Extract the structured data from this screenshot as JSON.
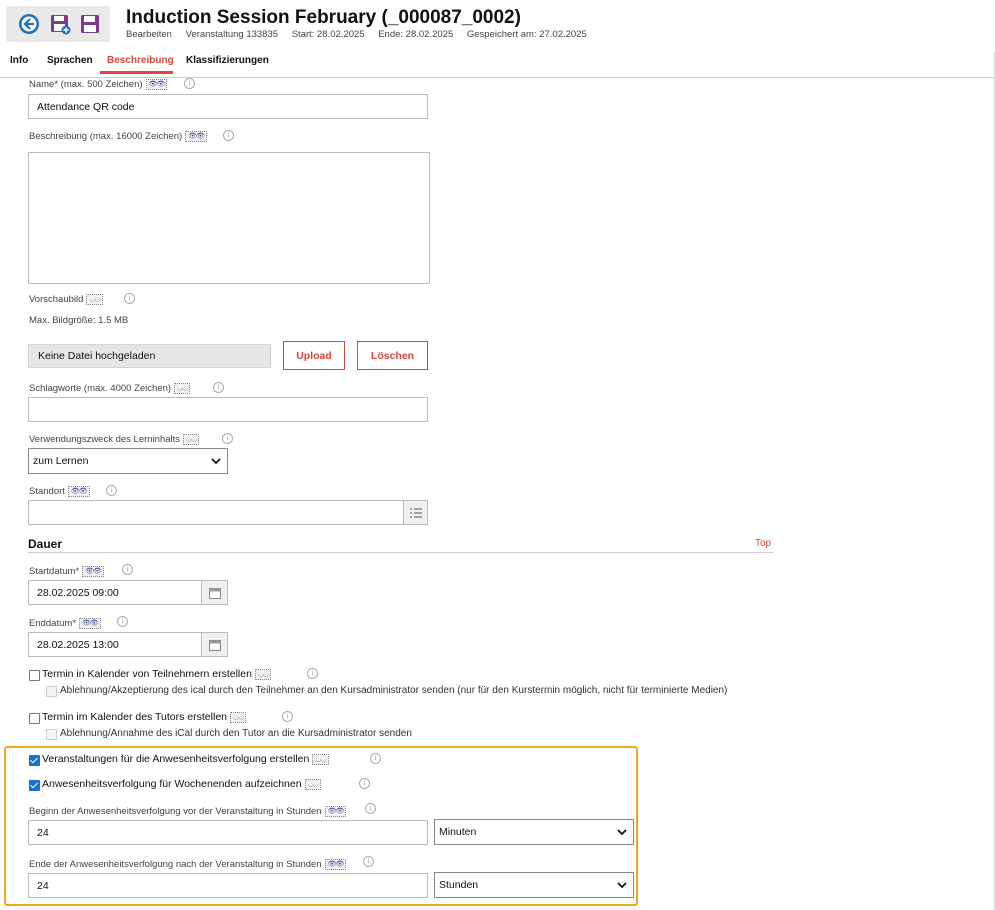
{
  "header": {
    "title": "Induction Session February (_000087_0002)",
    "meta": [
      "Bearbeiten",
      "Veranstaltung 133835",
      "Start: 28.02.2025",
      "Ende: 28.02.2025",
      "Gespeichert am: 27.02.2025"
    ],
    "toolbar_icons": [
      "back-icon",
      "save-new-icon",
      "save-icon"
    ]
  },
  "tabs": [
    {
      "label": "Info"
    },
    {
      "label": "Sprachen"
    },
    {
      "label": "Beschreibung",
      "active": true
    },
    {
      "label": "Klassifizierungen"
    }
  ],
  "form": {
    "name_label": "Name* (max. 500 Zeichen)",
    "name_value": "Attendance QR code",
    "beschreibung_label": "Beschreibung (max. 16000 Zeichen)",
    "vorschaubild_label": "Vorschaubild",
    "max_size": "Max. Bildgröße: 1.5 MB",
    "no_file": "Keine Datei hochgeladen",
    "upload": "Upload",
    "loeschen": "Löschen",
    "schlagworte_label": "Schlagworte (max. 4000 Zeichen)",
    "verwendung_label": "Verwendungszweck des Lerninhalts",
    "verwendung_value": "zum Lernen",
    "standort_label": "Standort"
  },
  "dauer": {
    "heading": "Dauer",
    "top_link": "Top",
    "start_label": "Startdatum*",
    "start_value": "28.02.2025 09:00",
    "end_label": "Enddatum*",
    "end_value": "28.02.2025 13:00",
    "cb1": "Termin in Kalender von Teilnehmern erstellen",
    "cb1_sub": "Ablehnung/Akzeptierung des ical durch den Teilnehmer an den Kursadministrator senden (nur für den Kurstermin möglich, nicht für terminierte Medien)",
    "cb2": "Termin im Kalender des Tutors erstellen",
    "cb2_sub": "Ablehnung/Annahme des iCal durch den Tutor an die Kursadministrator senden",
    "cb3": "Veranstaltungen für die Anwesenheitsverfolgung erstellen",
    "cb4": "Anwesenheitsverfolgung für Wochenenden aufzeichnen",
    "begin_label": "Beginn der Anwesenheitsverfolgung vor der Veranstaltung in Stunden",
    "begin_value": "24",
    "begin_unit": "Minuten",
    "end_track_label": "Ende der Anwesenheitsverfolgung nach der Veranstaltung in Stunden",
    "end_track_value": "24",
    "end_track_unit": "Stunden"
  },
  "colors": {
    "accent": "#e0463c",
    "highlight": "#f0a91c",
    "checkbox": "#1a6fd4"
  }
}
